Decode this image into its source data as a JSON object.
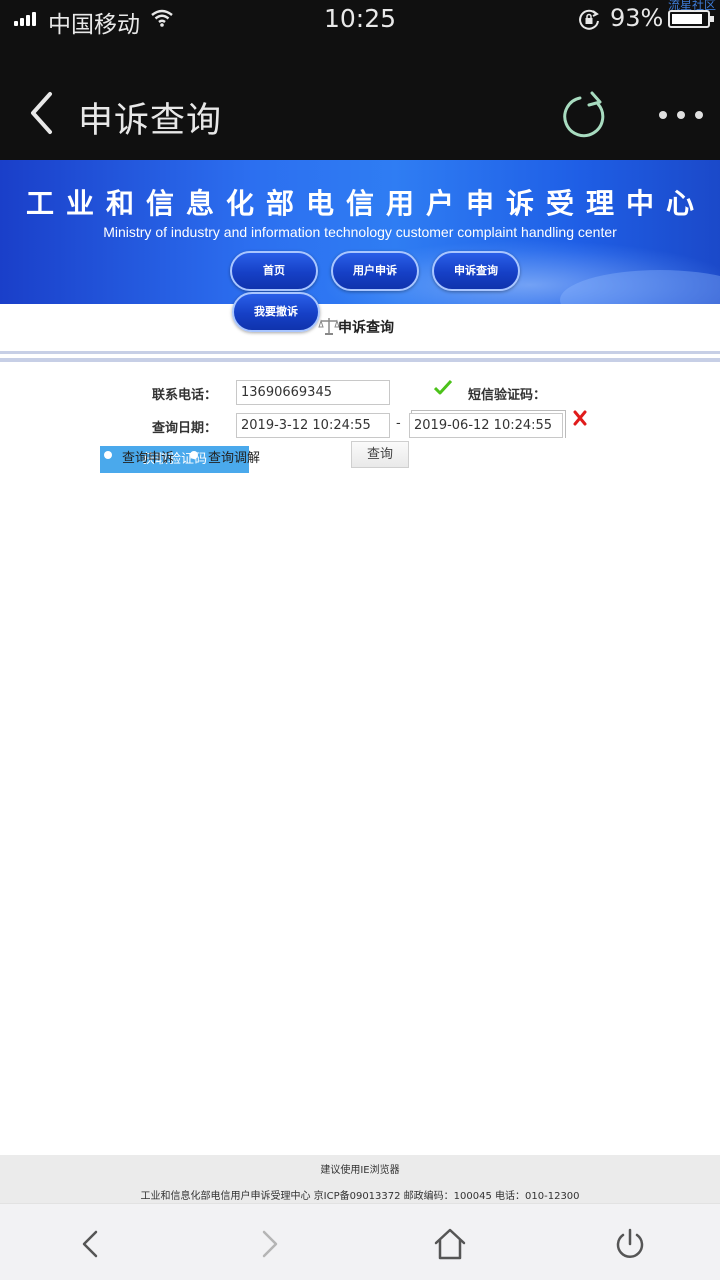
{
  "status_bar": {
    "carrier": "中国移动",
    "time": "10:25",
    "battery_percent": "93%",
    "watermark": "流星社区",
    "icons": [
      "signal-icon",
      "wifi-icon",
      "rotation-lock-icon",
      "battery-icon"
    ]
  },
  "app_bar": {
    "title": "申诉查询",
    "icons": [
      "back-arrow-icon",
      "refresh-icon",
      "more-options-icon"
    ]
  },
  "banner": {
    "title": "工业和信息化部电信用户申诉受理中心",
    "subtitle": "Ministry of industry and information technology customer complaint handling center",
    "nav": {
      "home": "首页",
      "user_complaint": "用户申诉",
      "complaint_query": "申诉查询",
      "withdraw": "我要撤诉"
    }
  },
  "section": {
    "title": "申诉查询",
    "icon": "scale-icon"
  },
  "form": {
    "phone_label": "联系电话：",
    "phone_value": "13690669345",
    "sms_code_label": "短信验证码：",
    "date_label": "查询日期：",
    "date_start": "2019-3-12 10:24:55",
    "date_separator": "-",
    "date_end": "2019-06-12 10:24:55",
    "get_code_button": "获取验证码",
    "radio_complaint_label": "查询申诉",
    "radio_mediation_label": "查询调解",
    "query_button": "查询",
    "icons": [
      "check-icon",
      "error-x-icon"
    ]
  },
  "footer": {
    "note": "建议使用IE浏览器",
    "info": "工业和信息化部电信用户申诉受理中心 京ICP备09013372 邮政编码：100045 电话：010-12300"
  },
  "bottom_nav": {
    "icons": [
      "back-icon",
      "forward-icon",
      "home-icon",
      "power-icon"
    ]
  },
  "colors": {
    "status_bar_bg": "#101010",
    "banner_blue": "#2c6ff0",
    "nav_button_blue": "#1640c6",
    "sms_button_blue": "#4aa9ec",
    "check_green": "#4cc21a",
    "error_red": "#e01b1b",
    "refresh_green": "#a8dcc0"
  }
}
